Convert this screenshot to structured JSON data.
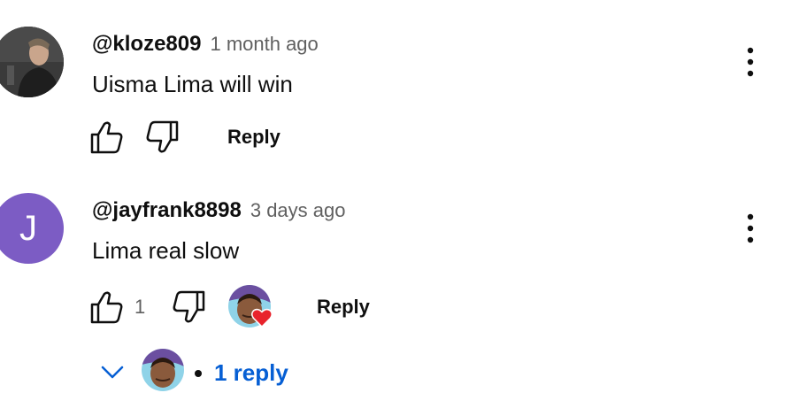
{
  "comments": [
    {
      "author": "@kloze809",
      "time": "1 month ago",
      "text": "Uisma Lima will win",
      "avatar": "photo-avatar",
      "reply_label": "Reply"
    },
    {
      "author": "@jayfrank8898",
      "time": "3 days ago",
      "text": "Lima real slow",
      "avatar_letter": "J",
      "avatar_color": "#7c5cc4",
      "like_count": "1",
      "creator_heart": true,
      "reply_label": "Reply",
      "replies_link": "1 reply"
    }
  ],
  "colors": {
    "link": "#065fd4",
    "secondary_text": "#606060",
    "heart": "#e8232c"
  }
}
